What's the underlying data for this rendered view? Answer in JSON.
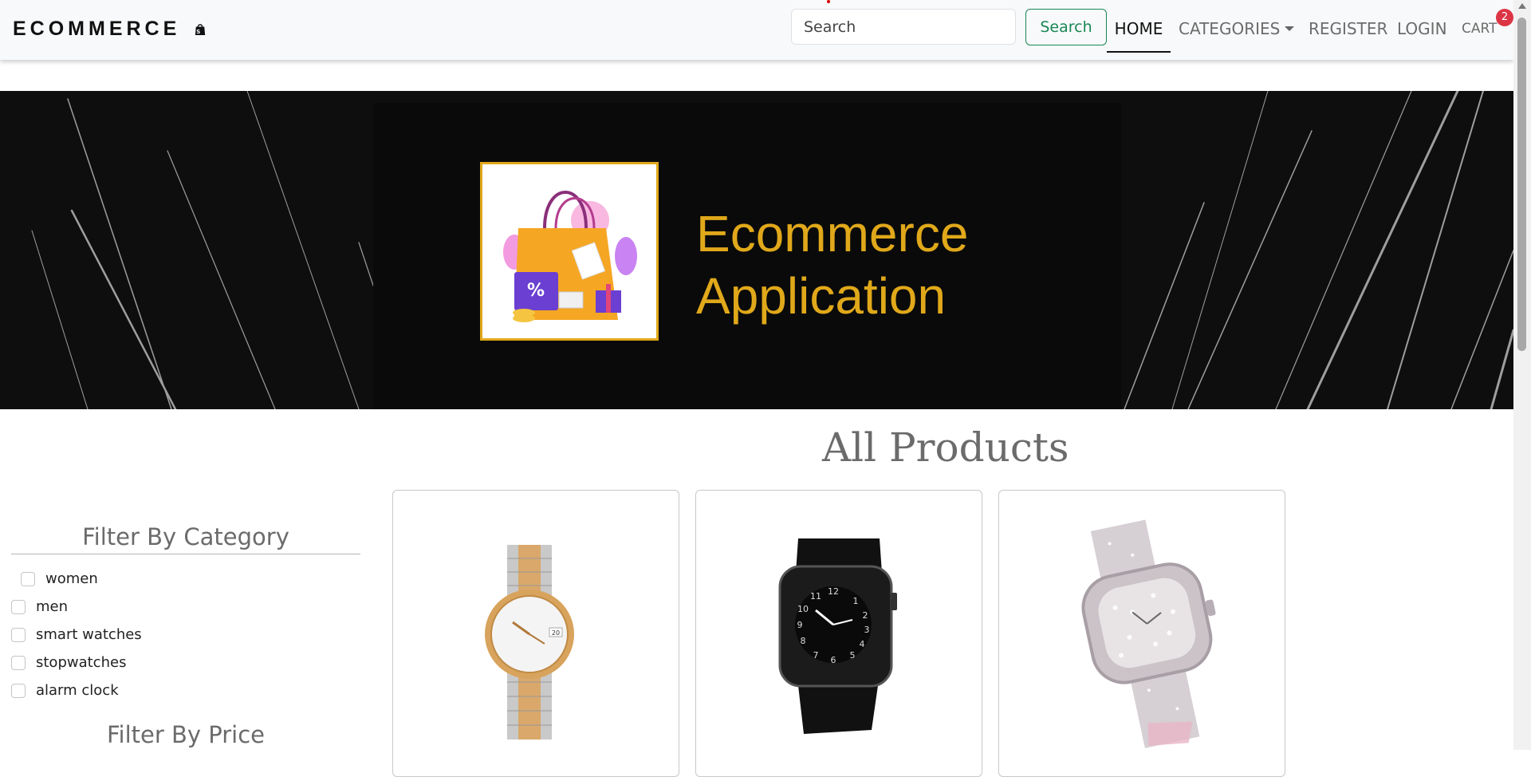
{
  "navbar": {
    "brand": "ECOMMERCE",
    "brand_icon": "shopping-bag-icon",
    "search_placeholder": "Search",
    "search_button": "Search",
    "links": {
      "home": "HOME",
      "categories": "CATEGORIES",
      "register": "REGISTER",
      "login": "LOGIN",
      "cart": "CART"
    },
    "cart_count": "2"
  },
  "banner": {
    "title": "Ecommerce\nApplication",
    "logo_icon": "shopping-bag-icon",
    "accent_color": "#e0a81a"
  },
  "main": {
    "heading": "All Products"
  },
  "sidebar": {
    "category_title": "Filter By Category",
    "categories": [
      "women",
      "men",
      "smart watches",
      "stopwatches",
      "alarm clock"
    ],
    "price_title": "Filter By Price"
  },
  "products": [
    {
      "image": "two-tone-analog-watch"
    },
    {
      "image": "black-smart-watch"
    },
    {
      "image": "diamond-studded-watch"
    }
  ],
  "colors": {
    "search_button": "#198754",
    "badge": "#dc3545",
    "heading": "#6b6b6b"
  }
}
